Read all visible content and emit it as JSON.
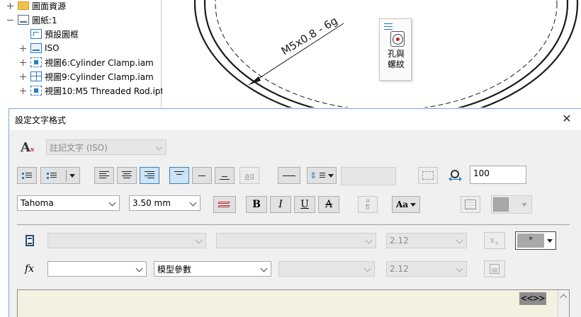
{
  "browser": {
    "items": [
      {
        "label": "圖面資源",
        "expander": "plus",
        "icon": "folder-icon"
      },
      {
        "label": "圖紙:1",
        "expander": "minus",
        "icon": "sheet-icon"
      },
      {
        "label": "預設圖框",
        "expander": "none",
        "icon": "border-icon"
      },
      {
        "label": "ISO",
        "expander": "plus",
        "icon": "title-block-icon"
      },
      {
        "label": "視圖6:Cylinder Clamp.iam",
        "expander": "plus",
        "icon": "view-icon"
      },
      {
        "label": "視圖9:Cylinder Clamp.iam",
        "expander": "plus",
        "icon": "view-icon"
      },
      {
        "label": "視圖10:M5 Threaded Rod.ipt",
        "expander": "plus",
        "icon": "view-icon"
      }
    ]
  },
  "canvas": {
    "dimension_text": "M5x0.8 - 6g",
    "marking_menu": {
      "label_line1": "孔與",
      "label_line2": "螺紋",
      "icon": "hole-thread-icon"
    }
  },
  "dialog": {
    "title": "設定文字格式",
    "close_glyph": "✕",
    "text_style": "註記文字 (ISO)",
    "stack_label": "ag",
    "line_spacing_value": "100",
    "font": "Tahoma",
    "font_size": "3.50 mm",
    "bold": "B",
    "italic": "I",
    "underline": "U",
    "strike": "A",
    "fraction_top": "a",
    "fraction_bottom": "b",
    "symbol_label": "Aa",
    "component_precision": "2.12",
    "param_precision": "2.12",
    "param_source": "模型參數",
    "fx_label": "fx",
    "degree_symbol": "°",
    "text_field": "<<>>",
    "colors": {
      "accent": "#3c7fb1",
      "text_area": "#f3f1df",
      "field_bg": "#8c8c8c"
    }
  }
}
